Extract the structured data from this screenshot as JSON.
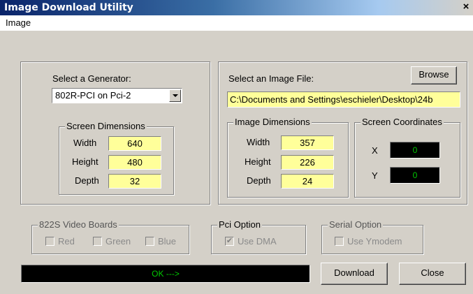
{
  "window": {
    "title": "Image Download Utility",
    "close_glyph": "×"
  },
  "menu": {
    "items": [
      "Image"
    ]
  },
  "generator": {
    "label": "Select a Generator:",
    "selected": "802R-PCI on Pci-2"
  },
  "screen_dimensions": {
    "legend": "Screen Dimensions",
    "width_label": "Width",
    "width": "640",
    "height_label": "Height",
    "height": "480",
    "depth_label": "Depth",
    "depth": "32"
  },
  "image_file": {
    "label": "Select an Image File:",
    "browse": "Browse",
    "path": "C:\\Documents and Settings\\eschieler\\Desktop\\24b"
  },
  "image_dimensions": {
    "legend": "Image Dimensions",
    "width_label": "Width",
    "width": "357",
    "height_label": "Height",
    "height": "226",
    "depth_label": "Depth",
    "depth": "24"
  },
  "screen_coordinates": {
    "legend": "Screen Coordinates",
    "x_label": "X",
    "x": "0",
    "y_label": "Y",
    "y": "0"
  },
  "video_boards": {
    "legend": "822S Video Boards",
    "red": "Red",
    "green": "Green",
    "blue": "Blue"
  },
  "pci_option": {
    "legend": "Pci Option",
    "use_dma": "Use DMA",
    "use_dma_checked": true
  },
  "serial_option": {
    "legend": "Serial Option",
    "use_ymodem": "Use Ymodem",
    "use_ymodem_checked": false
  },
  "status": {
    "text": "OK --->"
  },
  "buttons": {
    "download": "Download",
    "close": "Close"
  },
  "colors": {
    "field_yellow": "#ffff9a",
    "status_green": "#00c800",
    "title_blue": "#0a246a",
    "dialog_gray": "#d4d0c8"
  }
}
